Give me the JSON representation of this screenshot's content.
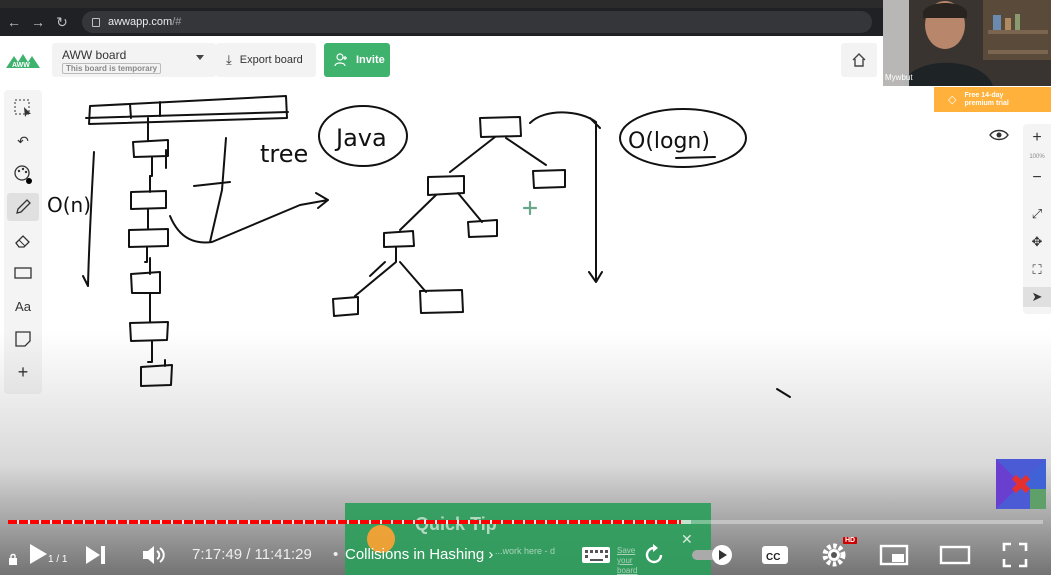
{
  "browser": {
    "url_host": "awwapp.com",
    "url_path": "/#"
  },
  "toolbar": {
    "board_name": "AWW board",
    "board_note": "This board is temporary",
    "export_label": "Export board",
    "invite_label": "Invite"
  },
  "webcam": {
    "label": "Mywbut"
  },
  "trial": {
    "label_line1": "Free 14-day",
    "label_line2": "premium trial"
  },
  "zoom": {
    "level": "100%"
  },
  "tools": [
    "select-icon",
    "undo-icon",
    "palette-icon",
    "pencil-icon",
    "eraser-icon",
    "rectangle-icon",
    "text-icon",
    "sticky-note-icon",
    "add-icon"
  ],
  "tool_text": "Aa",
  "handwriting": {
    "complexity_left": "O(n)",
    "tree_label": "tree",
    "java_label": "Java",
    "complexity_right": "O(logn)"
  },
  "quick_tip": {
    "title": "Quick Tip",
    "body": "...work here - d",
    "save": "Save your board to..."
  },
  "player": {
    "current_time": "7:17:49",
    "total_time": "11:41:29",
    "time_display": "7:17:49 / 11:41:29",
    "chapter": "Collisions in Hashing",
    "page_indicator": "1 / 1",
    "played_fraction": 0.65,
    "buffered_fraction": 0.66,
    "hd_badge": "HD",
    "colors": {
      "progress": "#ff0000",
      "invite": "#3fb26e",
      "trial": "#ffb13b",
      "quick_tip": "#2e9e5c"
    }
  }
}
